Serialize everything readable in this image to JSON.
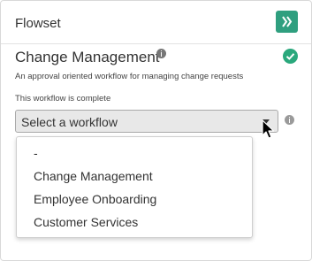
{
  "header": {
    "title": "Flowset"
  },
  "workflow": {
    "name": "Change Management",
    "description": "An approval oriented workflow for managing change requests",
    "status": "This workflow is complete"
  },
  "select": {
    "placeholder": "Select a workflow",
    "options": [
      "-",
      "Change Management",
      "Employee Onboarding",
      "Customer Services"
    ]
  },
  "colors": {
    "accent": "#2f9f7f",
    "check": "#2aa87c"
  },
  "icons": {
    "logo": "flowset-logo-icon",
    "info": "info-icon",
    "check": "check-circle-icon",
    "caret": "caret-down-icon",
    "cursor": "mouse-pointer-icon"
  }
}
